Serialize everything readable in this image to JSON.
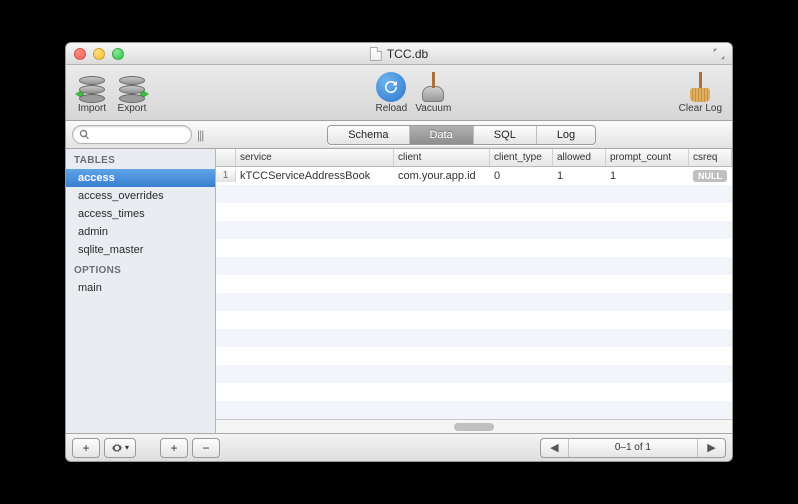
{
  "window": {
    "title": "TCC.db"
  },
  "toolbar": {
    "import_label": "Import",
    "export_label": "Export",
    "reload_label": "Reload",
    "vacuum_label": "Vacuum",
    "clearlog_label": "Clear Log"
  },
  "search": {
    "value": ""
  },
  "segments": {
    "schema": "Schema",
    "data": "Data",
    "sql": "SQL",
    "log": "Log",
    "active": "Data"
  },
  "sidebar": {
    "tables_header": "TABLES",
    "options_header": "OPTIONS",
    "tables": [
      "access",
      "access_overrides",
      "access_times",
      "admin",
      "sqlite_master"
    ],
    "options": [
      "main"
    ],
    "selected": "access"
  },
  "grid": {
    "columns": [
      "service",
      "client",
      "client_type",
      "allowed",
      "prompt_count",
      "csreq"
    ],
    "rows": [
      {
        "n": "1",
        "service": "kTCCServiceAddressBook",
        "client": "com.your.app.id",
        "client_type": "0",
        "allowed": "1",
        "prompt_count": "1",
        "csreq": "NULL"
      }
    ]
  },
  "footer": {
    "plus": "+",
    "gear": "⚙",
    "minus": "−",
    "page_info": "0–1 of 1"
  }
}
